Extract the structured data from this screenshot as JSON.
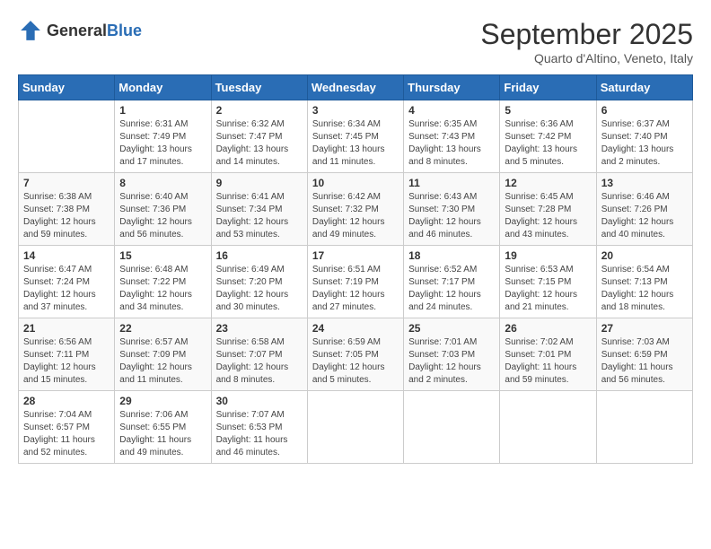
{
  "header": {
    "logo_general": "General",
    "logo_blue": "Blue",
    "month": "September 2025",
    "location": "Quarto d'Altino, Veneto, Italy"
  },
  "weekdays": [
    "Sunday",
    "Monday",
    "Tuesday",
    "Wednesday",
    "Thursday",
    "Friday",
    "Saturday"
  ],
  "weeks": [
    [
      {
        "day": "",
        "content": ""
      },
      {
        "day": "1",
        "content": "Sunrise: 6:31 AM\nSunset: 7:49 PM\nDaylight: 13 hours\nand 17 minutes."
      },
      {
        "day": "2",
        "content": "Sunrise: 6:32 AM\nSunset: 7:47 PM\nDaylight: 13 hours\nand 14 minutes."
      },
      {
        "day": "3",
        "content": "Sunrise: 6:34 AM\nSunset: 7:45 PM\nDaylight: 13 hours\nand 11 minutes."
      },
      {
        "day": "4",
        "content": "Sunrise: 6:35 AM\nSunset: 7:43 PM\nDaylight: 13 hours\nand 8 minutes."
      },
      {
        "day": "5",
        "content": "Sunrise: 6:36 AM\nSunset: 7:42 PM\nDaylight: 13 hours\nand 5 minutes."
      },
      {
        "day": "6",
        "content": "Sunrise: 6:37 AM\nSunset: 7:40 PM\nDaylight: 13 hours\nand 2 minutes."
      }
    ],
    [
      {
        "day": "7",
        "content": "Sunrise: 6:38 AM\nSunset: 7:38 PM\nDaylight: 12 hours\nand 59 minutes."
      },
      {
        "day": "8",
        "content": "Sunrise: 6:40 AM\nSunset: 7:36 PM\nDaylight: 12 hours\nand 56 minutes."
      },
      {
        "day": "9",
        "content": "Sunrise: 6:41 AM\nSunset: 7:34 PM\nDaylight: 12 hours\nand 53 minutes."
      },
      {
        "day": "10",
        "content": "Sunrise: 6:42 AM\nSunset: 7:32 PM\nDaylight: 12 hours\nand 49 minutes."
      },
      {
        "day": "11",
        "content": "Sunrise: 6:43 AM\nSunset: 7:30 PM\nDaylight: 12 hours\nand 46 minutes."
      },
      {
        "day": "12",
        "content": "Sunrise: 6:45 AM\nSunset: 7:28 PM\nDaylight: 12 hours\nand 43 minutes."
      },
      {
        "day": "13",
        "content": "Sunrise: 6:46 AM\nSunset: 7:26 PM\nDaylight: 12 hours\nand 40 minutes."
      }
    ],
    [
      {
        "day": "14",
        "content": "Sunrise: 6:47 AM\nSunset: 7:24 PM\nDaylight: 12 hours\nand 37 minutes."
      },
      {
        "day": "15",
        "content": "Sunrise: 6:48 AM\nSunset: 7:22 PM\nDaylight: 12 hours\nand 34 minutes."
      },
      {
        "day": "16",
        "content": "Sunrise: 6:49 AM\nSunset: 7:20 PM\nDaylight: 12 hours\nand 30 minutes."
      },
      {
        "day": "17",
        "content": "Sunrise: 6:51 AM\nSunset: 7:19 PM\nDaylight: 12 hours\nand 27 minutes."
      },
      {
        "day": "18",
        "content": "Sunrise: 6:52 AM\nSunset: 7:17 PM\nDaylight: 12 hours\nand 24 minutes."
      },
      {
        "day": "19",
        "content": "Sunrise: 6:53 AM\nSunset: 7:15 PM\nDaylight: 12 hours\nand 21 minutes."
      },
      {
        "day": "20",
        "content": "Sunrise: 6:54 AM\nSunset: 7:13 PM\nDaylight: 12 hours\nand 18 minutes."
      }
    ],
    [
      {
        "day": "21",
        "content": "Sunrise: 6:56 AM\nSunset: 7:11 PM\nDaylight: 12 hours\nand 15 minutes."
      },
      {
        "day": "22",
        "content": "Sunrise: 6:57 AM\nSunset: 7:09 PM\nDaylight: 12 hours\nand 11 minutes."
      },
      {
        "day": "23",
        "content": "Sunrise: 6:58 AM\nSunset: 7:07 PM\nDaylight: 12 hours\nand 8 minutes."
      },
      {
        "day": "24",
        "content": "Sunrise: 6:59 AM\nSunset: 7:05 PM\nDaylight: 12 hours\nand 5 minutes."
      },
      {
        "day": "25",
        "content": "Sunrise: 7:01 AM\nSunset: 7:03 PM\nDaylight: 12 hours\nand 2 minutes."
      },
      {
        "day": "26",
        "content": "Sunrise: 7:02 AM\nSunset: 7:01 PM\nDaylight: 11 hours\nand 59 minutes."
      },
      {
        "day": "27",
        "content": "Sunrise: 7:03 AM\nSunset: 6:59 PM\nDaylight: 11 hours\nand 56 minutes."
      }
    ],
    [
      {
        "day": "28",
        "content": "Sunrise: 7:04 AM\nSunset: 6:57 PM\nDaylight: 11 hours\nand 52 minutes."
      },
      {
        "day": "29",
        "content": "Sunrise: 7:06 AM\nSunset: 6:55 PM\nDaylight: 11 hours\nand 49 minutes."
      },
      {
        "day": "30",
        "content": "Sunrise: 7:07 AM\nSunset: 6:53 PM\nDaylight: 11 hours\nand 46 minutes."
      },
      {
        "day": "",
        "content": ""
      },
      {
        "day": "",
        "content": ""
      },
      {
        "day": "",
        "content": ""
      },
      {
        "day": "",
        "content": ""
      }
    ]
  ]
}
